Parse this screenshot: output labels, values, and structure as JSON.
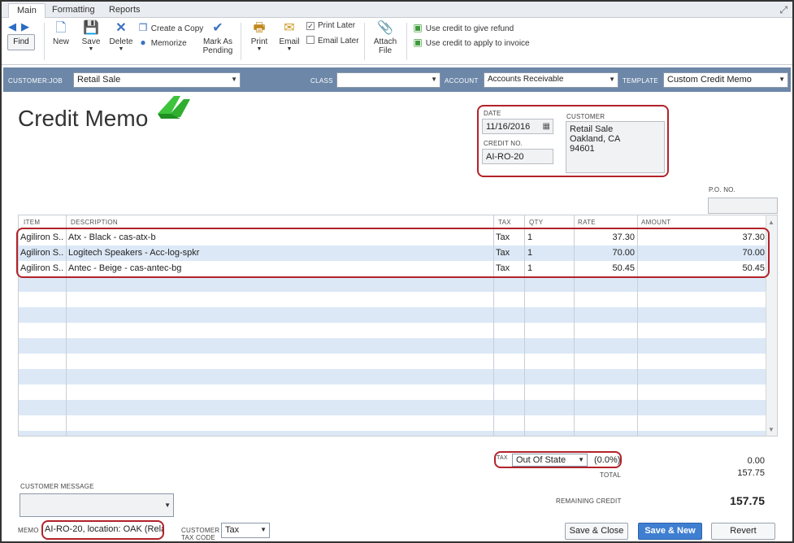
{
  "tabs": [
    "Main",
    "Formatting",
    "Reports"
  ],
  "toolbar": {
    "find": "Find",
    "new": "New",
    "save": "Save",
    "delete": "Delete",
    "create_copy": "Create a Copy",
    "memorize": "Memorize",
    "mark_as_pending_1": "Mark As",
    "mark_as_pending_2": "Pending",
    "print": "Print",
    "email": "Email",
    "print_later": "Print Later",
    "email_later": "Email Later",
    "attach_file_1": "Attach",
    "attach_file_2": "File",
    "refund": "Use credit to give refund",
    "apply_invoice": "Use credit to apply to invoice"
  },
  "header": {
    "customer_job_label": "CUSTOMER:JOB",
    "customer_job_value": "Retail Sale",
    "class_label": "CLASS",
    "class_value": "",
    "account_label": "ACCOUNT",
    "account_value": "Accounts Receivable",
    "template_label": "TEMPLATE",
    "template_value": "Custom Credit Memo"
  },
  "form": {
    "title": "Credit Memo",
    "date_label": "DATE",
    "date_value": "11/16/2016",
    "credit_no_label": "CREDIT NO.",
    "credit_no_value": "AI-RO-20",
    "customer_label": "CUSTOMER",
    "customer_line1": "Retail Sale",
    "customer_line2": "Oakland, CA",
    "customer_line3": "94601",
    "po_label": "P.O. NO.",
    "po_value": ""
  },
  "grid": {
    "headers": [
      "ITEM",
      "DESCRIPTION",
      "TAX",
      "QTY",
      "RATE",
      "AMOUNT"
    ],
    "rows": [
      {
        "item": "Agiliron S...",
        "description": "Atx - Black  - cas-atx-b",
        "tax": "Tax",
        "qty": "1",
        "rate": "37.30",
        "amount": "37.30"
      },
      {
        "item": "Agiliron S...",
        "description": "Logitech Speakers  - Acc-log-spkr",
        "tax": "Tax",
        "qty": "1",
        "rate": "70.00",
        "amount": "70.00"
      },
      {
        "item": "Agiliron S...",
        "description": "Antec - Beige  - cas-antec-bg",
        "tax": "Tax",
        "qty": "1",
        "rate": "50.45",
        "amount": "50.45"
      }
    ]
  },
  "footer": {
    "tax_label": "TAX",
    "tax_value": "Out Of State",
    "tax_rate": "(0.0%)",
    "tax_amount": "0.00",
    "total_label": "TOTAL",
    "total_value": "157.75",
    "customer_message_label": "CUSTOMER MESSAGE",
    "remaining_credit_label": "REMAINING CREDIT",
    "remaining_credit_value": "157.75",
    "memo_label": "MEMO",
    "memo_value": "AI-RO-20, location: OAK (Relat...",
    "customer_tax_code_label_1": "CUSTOMER",
    "customer_tax_code_label_2": "TAX CODE",
    "customer_tax_code_value": "Tax",
    "save_close": "Save & Close",
    "save_new": "Save & New",
    "revert": "Revert"
  },
  "colors": {
    "header_bar": "#6d87a8",
    "highlight": "#b3222a",
    "row_alt": "#dce8f6",
    "primary_button": "#3f7fd2"
  }
}
